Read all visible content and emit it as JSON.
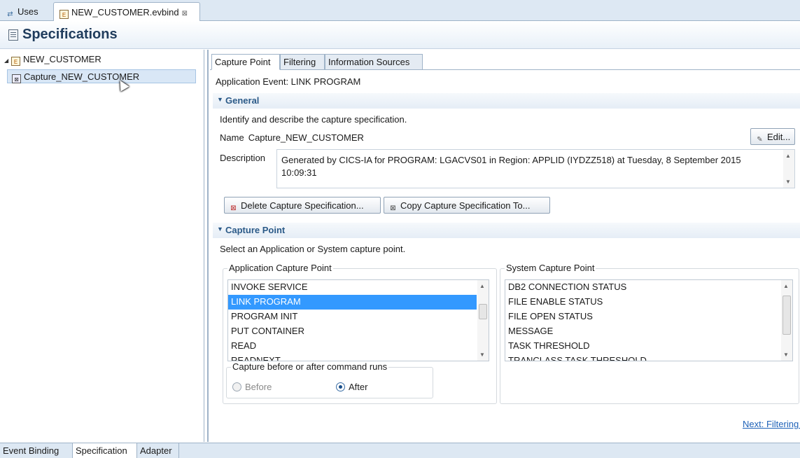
{
  "editor_tabs": {
    "uses": "Uses",
    "active_file": "NEW_CUSTOMER.evbind",
    "close_glyph": "⊠"
  },
  "header": {
    "title": "Specifications",
    "icon": "specifications-icon"
  },
  "tree": {
    "root": "NEW_CUSTOMER",
    "child": "Capture_NEW_CUSTOMER"
  },
  "inner_tabs": [
    "Capture Point",
    "Filtering",
    "Information Sources"
  ],
  "application_event": "Application Event: LINK PROGRAM",
  "general": {
    "title": "General",
    "description": "Identify and describe the capture specification.",
    "name_label": "Name",
    "name_value": "Capture_NEW_CUSTOMER",
    "edit_button": "Edit...",
    "description_label": "Description",
    "description_value": "Generated by CICS-IA for PROGRAM: LGACVS01 in Region: APPLID (IYDZZ518) at Tuesday, 8 September 2015 10:09:31",
    "delete_button": "Delete Capture Specification...",
    "copy_button": "Copy Capture Specification To..."
  },
  "capture_point": {
    "title": "Capture Point",
    "description": "Select an Application or System capture point.",
    "application_title": "Application Capture Point",
    "application_items": [
      "INVOKE SERVICE",
      "LINK PROGRAM",
      "PROGRAM INIT",
      "PUT CONTAINER",
      "READ",
      "READNEXT"
    ],
    "application_selected": "LINK PROGRAM",
    "system_title": "System Capture Point",
    "system_items": [
      "DB2 CONNECTION STATUS",
      "FILE ENABLE STATUS",
      "FILE OPEN STATUS",
      "MESSAGE",
      "TASK THRESHOLD",
      "TRANCLASS TASK THRESHOLD"
    ],
    "before_after_title": "Capture before or after command runs",
    "before_label": "Before",
    "after_label": "After",
    "selected_option": "After"
  },
  "next_link": "Next: Filtering ->",
  "bottom_tabs": [
    "Event Binding",
    "Specification",
    "Adapter"
  ],
  "colors": {
    "selection": "#3399ff",
    "section_title": "#2b5a88",
    "link": "#1e62b8"
  }
}
